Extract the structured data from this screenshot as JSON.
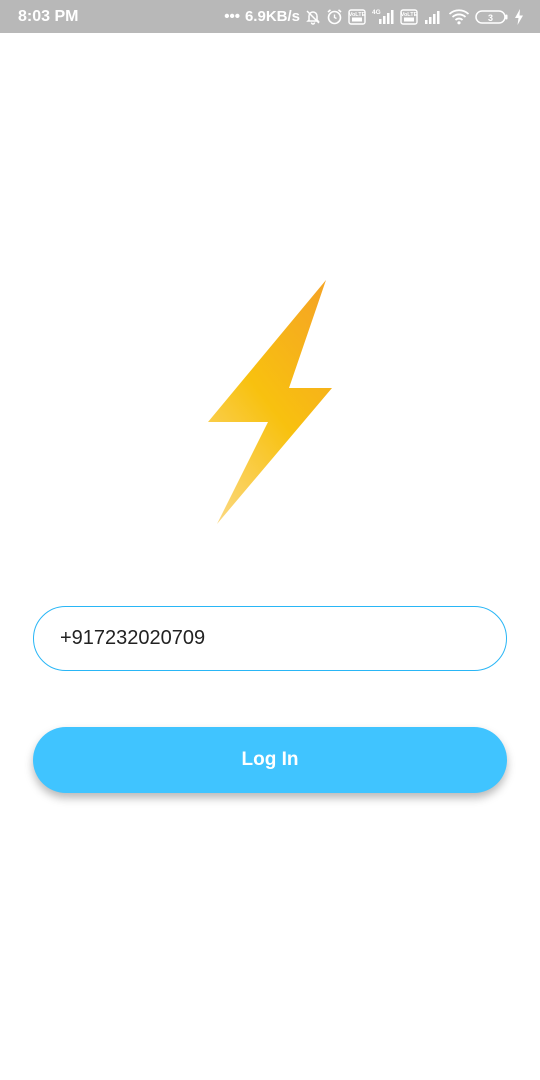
{
  "status_bar": {
    "time": "8:03 PM",
    "dots": "•••",
    "net_speed": "6.9KB/s",
    "sim1_label": "VoLTE",
    "network_type": "4G",
    "sim2_label": "VoLTE",
    "battery_level": "3",
    "icons": [
      "bell-off-icon",
      "alarm-icon",
      "volte-icon",
      "signal-icon",
      "volte-icon",
      "signal-icon",
      "wifi-icon",
      "battery-icon",
      "charging-icon"
    ]
  },
  "logo": {
    "icon": "lightning-bolt-icon",
    "colors": [
      "#f5a623",
      "#f8c10f",
      "#fbd06a"
    ]
  },
  "login_form": {
    "phone_value": "+917232020709",
    "login_label": "Log In"
  },
  "colors": {
    "accent": "#40c4ff",
    "field_border": "#29b6f6"
  }
}
